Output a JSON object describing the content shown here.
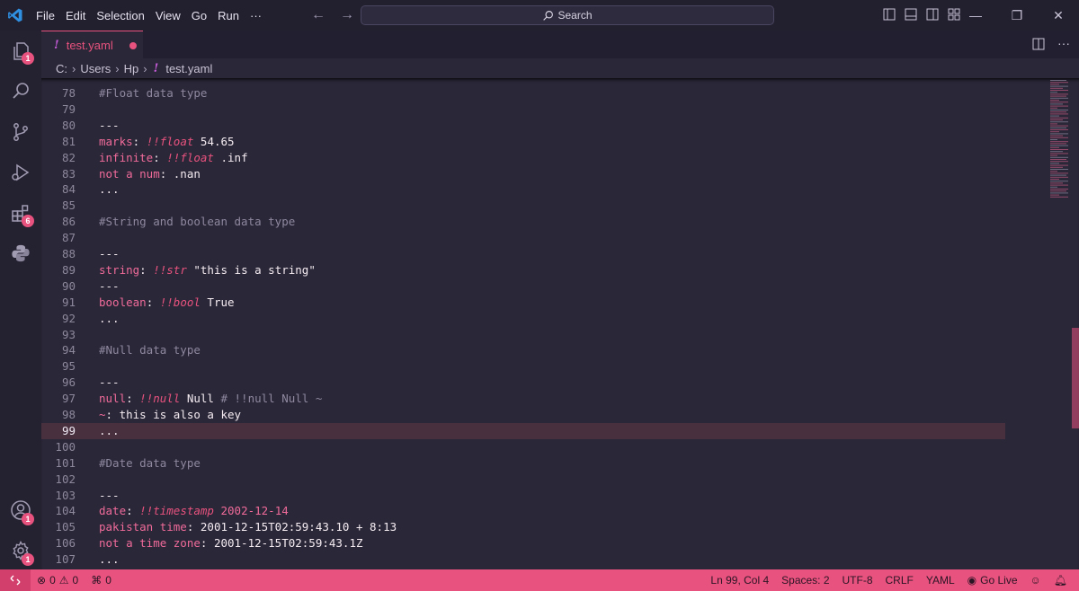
{
  "menu": [
    "File",
    "Edit",
    "Selection",
    "View",
    "Go",
    "Run",
    "···"
  ],
  "search": {
    "label": "Search"
  },
  "activity": {
    "explorer_badge": "1",
    "extensions_badge": "6",
    "accounts_badge": "1",
    "settings_badge": "1"
  },
  "tab": {
    "label": "test.yaml"
  },
  "breadcrumb": [
    "C:",
    "Users",
    "Hp",
    "test.yaml"
  ],
  "editor": {
    "current_line": 99,
    "lines": [
      {
        "n": "78",
        "tokens": [
          {
            "c": "cmt",
            "t": "#Float data type"
          }
        ]
      },
      {
        "n": "79",
        "tokens": []
      },
      {
        "n": "80",
        "tokens": [
          {
            "c": "val",
            "t": "---"
          }
        ]
      },
      {
        "n": "81",
        "tokens": [
          {
            "c": "key",
            "t": "marks"
          },
          {
            "c": "val",
            "t": ": "
          },
          {
            "c": "tag",
            "t": "!!float"
          },
          {
            "c": "val",
            "t": " 54.65"
          }
        ]
      },
      {
        "n": "82",
        "tokens": [
          {
            "c": "key",
            "t": "infinite"
          },
          {
            "c": "val",
            "t": ": "
          },
          {
            "c": "tag",
            "t": "!!float"
          },
          {
            "c": "val",
            "t": " .inf"
          }
        ]
      },
      {
        "n": "83",
        "tokens": [
          {
            "c": "key",
            "t": "not a num"
          },
          {
            "c": "val",
            "t": ": .nan"
          }
        ]
      },
      {
        "n": "84",
        "tokens": [
          {
            "c": "val",
            "t": "..."
          }
        ]
      },
      {
        "n": "85",
        "tokens": []
      },
      {
        "n": "86",
        "tokens": [
          {
            "c": "cmt",
            "t": "#String and boolean data type"
          }
        ]
      },
      {
        "n": "87",
        "tokens": []
      },
      {
        "n": "88",
        "tokens": [
          {
            "c": "val",
            "t": "---"
          }
        ]
      },
      {
        "n": "89",
        "tokens": [
          {
            "c": "key",
            "t": "string"
          },
          {
            "c": "val",
            "t": ": "
          },
          {
            "c": "tag",
            "t": "!!str"
          },
          {
            "c": "strv",
            "t": " \"this is a string\""
          }
        ]
      },
      {
        "n": "90",
        "tokens": [
          {
            "c": "val",
            "t": "---"
          }
        ]
      },
      {
        "n": "91",
        "tokens": [
          {
            "c": "key",
            "t": "boolean"
          },
          {
            "c": "val",
            "t": ": "
          },
          {
            "c": "tag",
            "t": "!!bool"
          },
          {
            "c": "val",
            "t": " True"
          }
        ]
      },
      {
        "n": "92",
        "tokens": [
          {
            "c": "val",
            "t": "..."
          }
        ]
      },
      {
        "n": "93",
        "tokens": []
      },
      {
        "n": "94",
        "tokens": [
          {
            "c": "cmt",
            "t": "#Null data type"
          }
        ]
      },
      {
        "n": "95",
        "tokens": []
      },
      {
        "n": "96",
        "tokens": [
          {
            "c": "val",
            "t": "---"
          }
        ]
      },
      {
        "n": "97",
        "tokens": [
          {
            "c": "key",
            "t": "null"
          },
          {
            "c": "val",
            "t": ": "
          },
          {
            "c": "tag",
            "t": "!!null"
          },
          {
            "c": "val",
            "t": " Null "
          },
          {
            "c": "cmt",
            "t": "# !!null Null ~"
          }
        ]
      },
      {
        "n": "98",
        "tokens": [
          {
            "c": "key",
            "t": "~"
          },
          {
            "c": "val",
            "t": ": this is also a key"
          }
        ]
      },
      {
        "n": "99",
        "tokens": [
          {
            "c": "val",
            "t": "..."
          }
        ]
      },
      {
        "n": "100",
        "tokens": []
      },
      {
        "n": "101",
        "tokens": [
          {
            "c": "cmt",
            "t": "#Date data type"
          }
        ]
      },
      {
        "n": "102",
        "tokens": []
      },
      {
        "n": "103",
        "tokens": [
          {
            "c": "val",
            "t": "---"
          }
        ]
      },
      {
        "n": "104",
        "tokens": [
          {
            "c": "key",
            "t": "date"
          },
          {
            "c": "val",
            "t": ": "
          },
          {
            "c": "tag",
            "t": "!!timestamp"
          },
          {
            "c": "key",
            "t": " 2002-12-14"
          }
        ]
      },
      {
        "n": "105",
        "tokens": [
          {
            "c": "key",
            "t": "pakistan time"
          },
          {
            "c": "val",
            "t": ": 2001-12-15T02:59:43.10 + 8:13"
          }
        ]
      },
      {
        "n": "106",
        "tokens": [
          {
            "c": "key",
            "t": "not a time zone"
          },
          {
            "c": "val",
            "t": ": 2001-12-15T02:59:43.1Z"
          }
        ]
      },
      {
        "n": "107",
        "tokens": [
          {
            "c": "val",
            "t": "..."
          }
        ]
      }
    ]
  },
  "status": {
    "errors": "0",
    "warnings": "0",
    "ports": "0",
    "position": "Ln 99, Col 4",
    "spaces": "Spaces: 2",
    "encoding": "UTF-8",
    "eol": "CRLF",
    "language": "YAML",
    "golive": "Go Live"
  },
  "colors": {
    "accent": "#e8527e",
    "background": "#2a2738",
    "comment": "#8f889f"
  }
}
